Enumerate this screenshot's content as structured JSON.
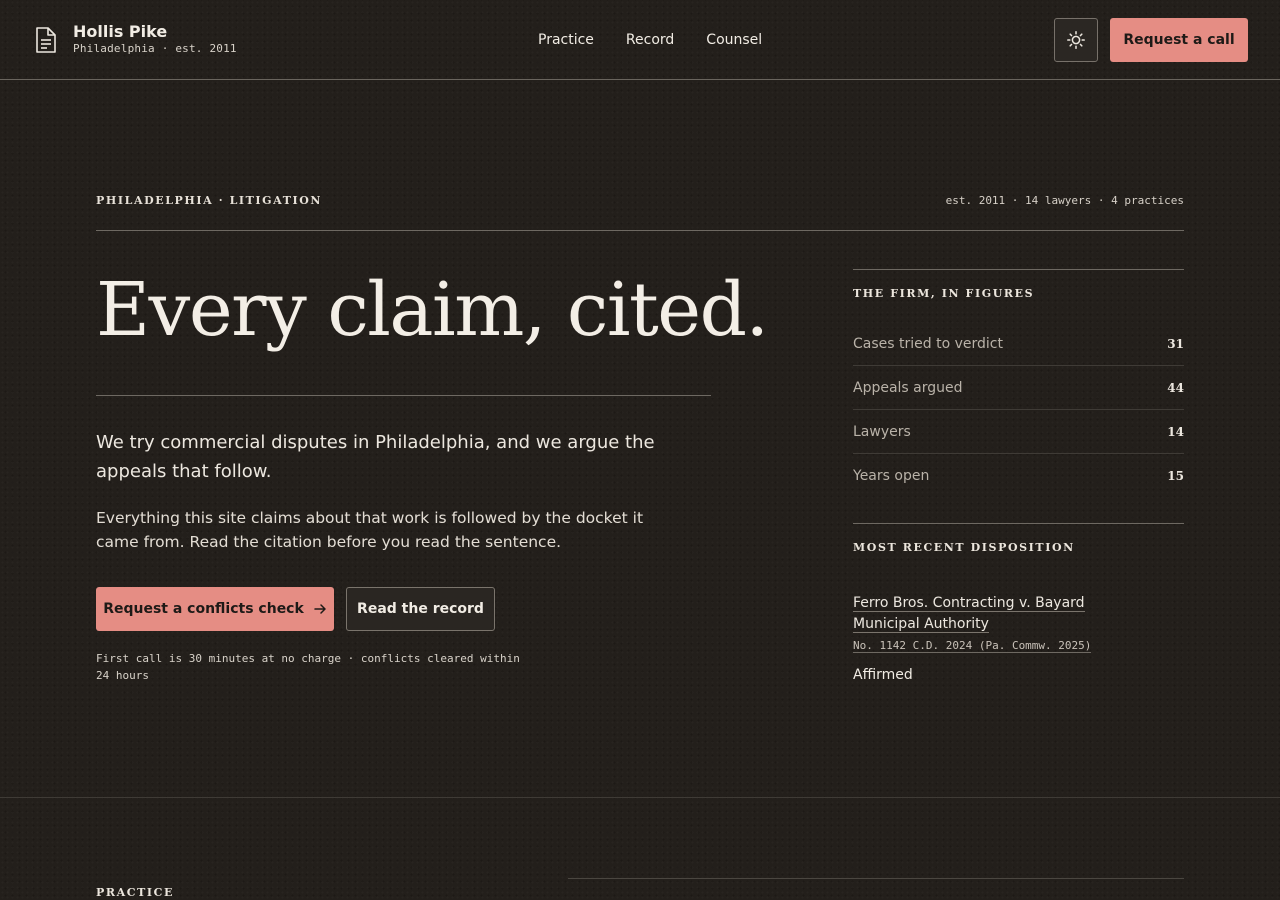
{
  "brand": {
    "name": "Hollis Pike",
    "subtitle": "Philadelphia · est. 2011"
  },
  "nav": {
    "items": [
      "Practice",
      "Record",
      "Counsel"
    ]
  },
  "header": {
    "theme_icon": "sun-icon",
    "cta_label": "Request a call"
  },
  "hero": {
    "eyebrow": "PHILADELPHIA · LITIGATION",
    "meta": "est. 2011 · 14 lawyers · 4 practices",
    "headline": "Every claim, cited.",
    "lead": "We try commercial disputes in Philadelphia, and we argue the appeals that follow.",
    "body": "Everything this site claims about that work is followed by the docket it came from. Read the citation before you read the sentence.",
    "primary_cta": "Request a conflicts check",
    "secondary_cta": "Read the record",
    "fine_print": "First call is 30 minutes at no charge · conflicts cleared within 24 hours"
  },
  "figures": {
    "title": "THE FIRM, IN FIGURES",
    "rows": [
      {
        "label": "Cases tried to verdict",
        "value": "31"
      },
      {
        "label": "Appeals argued",
        "value": "44"
      },
      {
        "label": "Lawyers",
        "value": "14"
      },
      {
        "label": "Years open",
        "value": "15"
      }
    ]
  },
  "disposition": {
    "title": "MOST RECENT DISPOSITION",
    "case_name": "Ferro Bros. Contracting v. Bayard Municipal Authority",
    "docket": "No. 1142 C.D. 2024 (Pa. Commw. 2025)",
    "outcome": "Affirmed"
  },
  "practice": {
    "label": "PRACTICE"
  },
  "colors": {
    "accent": "#e58d84",
    "background": "#231f1b",
    "text": "#ece7df"
  }
}
